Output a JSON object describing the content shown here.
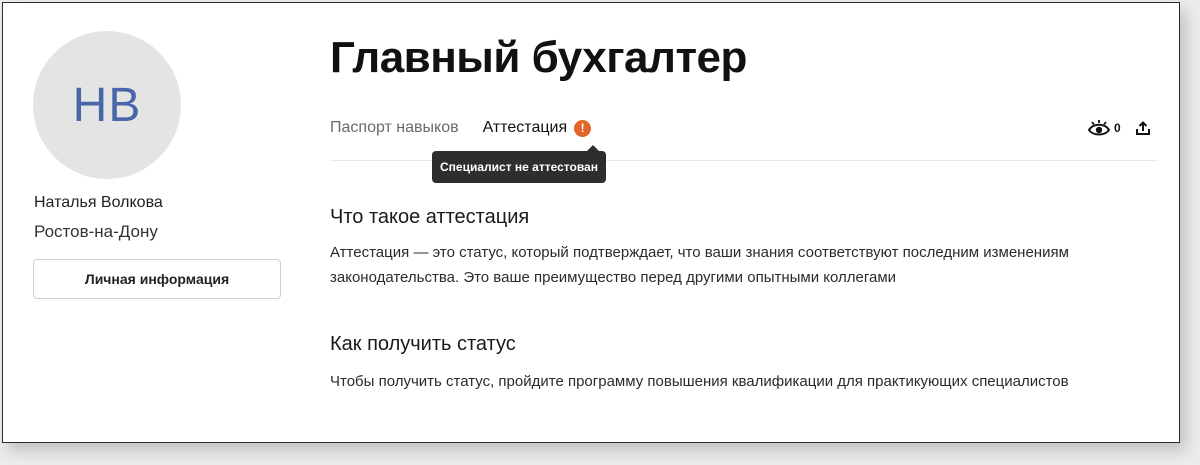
{
  "profile": {
    "initials": "НВ",
    "name": "Наталья Волкова",
    "city": "Ростов-на-Дону",
    "info_button": "Личная информация"
  },
  "page": {
    "title": "Главный бухгалтер"
  },
  "tabs": [
    {
      "label": "Паспорт навыков",
      "active": false
    },
    {
      "label": "Аттестация",
      "active": true
    }
  ],
  "alert_icon": {
    "icon": "exclamation-icon",
    "glyph": "!",
    "color": "#e2662a"
  },
  "tooltip": "Специалист не аттестован",
  "actions": {
    "views_icon": "eye-icon",
    "views_count": "0",
    "share_icon": "share-icon"
  },
  "sections": [
    {
      "title": "Что такое аттестация",
      "text": "Аттестация — это статус, который подтверждает, что ваши знания соответствуют последним изменениям законодательства. Это ваше преимущество перед другими опытными коллегами"
    },
    {
      "title": "Как получить статус",
      "text": "Чтобы получить статус, пройдите программу повышения квалификации для практикующих специалистов"
    }
  ],
  "colors": {
    "avatar_bg": "#e4e4e4",
    "avatar_text": "#4a66aa",
    "alert": "#e2662a",
    "tooltip_bg": "#2e2e2e"
  }
}
